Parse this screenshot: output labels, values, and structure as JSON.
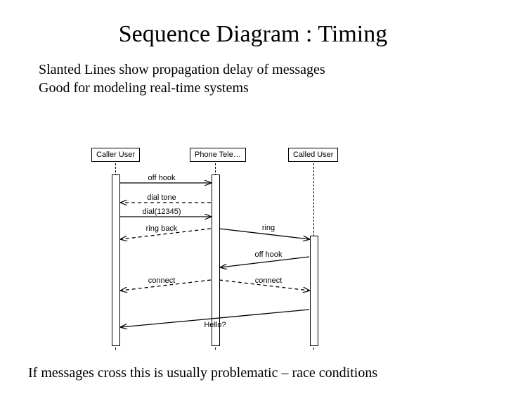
{
  "title": "Sequence Diagram : Timing",
  "subtitle_line1": "Slanted Lines show propagation delay of messages",
  "subtitle_line2": "Good for modeling real-time systems",
  "footnote": "If messages cross this is usually problematic – race conditions",
  "actors": {
    "caller": "Caller User",
    "tele": "Phone Tele…",
    "callee": "Called User"
  },
  "messages": {
    "off_hook1": "off hook",
    "dial_tone": "dial tone",
    "dial": "dial(12345)",
    "ring_back": "ring back",
    "ring": "ring",
    "off_hook2": "off hook",
    "connect1": "connect",
    "connect2": "connect",
    "hello": "Hello?"
  }
}
